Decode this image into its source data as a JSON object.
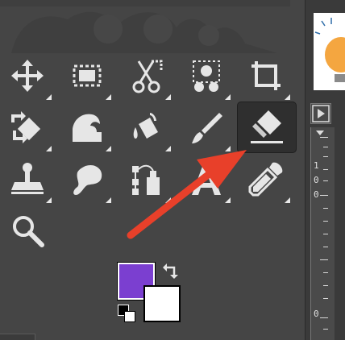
{
  "toolbox": {
    "tools": [
      {
        "name": "move-tool",
        "icon": "move-icon"
      },
      {
        "name": "rect-select-tool",
        "icon": "rect-select-icon"
      },
      {
        "name": "cut-tool",
        "icon": "scissors-icon"
      },
      {
        "name": "fuzzy-select-tool",
        "icon": "fuzzy-select-icon"
      },
      {
        "name": "crop-tool",
        "icon": "crop-icon"
      },
      {
        "name": "transform-tool",
        "icon": "transform-icon"
      },
      {
        "name": "warp-tool",
        "icon": "warp-icon"
      },
      {
        "name": "bucket-fill-tool",
        "icon": "bucket-fill-icon"
      },
      {
        "name": "paintbrush-tool",
        "icon": "paintbrush-icon"
      },
      {
        "name": "eraser-tool",
        "icon": "eraser-icon",
        "active": true
      },
      {
        "name": "clone-tool",
        "icon": "clone-stamp-icon"
      },
      {
        "name": "smudge-tool",
        "icon": "smudge-icon"
      },
      {
        "name": "paths-tool",
        "icon": "paths-icon"
      },
      {
        "name": "text-tool",
        "icon": "text-icon"
      },
      {
        "name": "color-picker-tool",
        "icon": "eyedropper-icon"
      },
      {
        "name": "zoom-tool",
        "icon": "magnifier-icon"
      }
    ],
    "foreground_color": "#7b3fd0",
    "background_color": "#ffffff"
  },
  "annotation": {
    "arrow_color": "#e8402a"
  },
  "ruler": {
    "labels": [
      "1",
      "0",
      "0",
      "0"
    ]
  }
}
